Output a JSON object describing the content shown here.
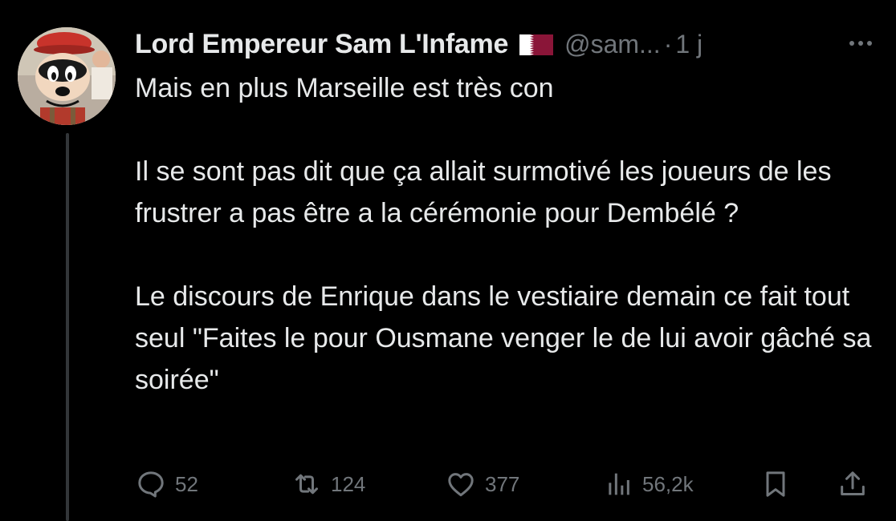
{
  "author": {
    "display_name": "Lord Empereur Sam L'Infame",
    "flag_icon": "qatar-flag-icon",
    "handle": "@sam...",
    "separator": "·",
    "time": "1 j"
  },
  "tweet": {
    "paragraphs": [
      "Mais en plus Marseille est très con",
      "Il se sont pas dit que ça allait surmotivé les joueurs de les frustrer a pas être a la cérémonie pour Dembélé ?",
      "Le discours de Enrique dans le vestiaire demain ce fait tout seul \"Faites le pour Ousmane venger le de lui avoir gâché sa soirée\""
    ]
  },
  "actions": {
    "reply": {
      "icon": "reply-icon",
      "count": "52"
    },
    "retweet": {
      "icon": "retweet-icon",
      "count": "124"
    },
    "like": {
      "icon": "heart-icon",
      "count": "377"
    },
    "views": {
      "icon": "views-chart-icon",
      "count": "56,2k"
    },
    "bookmark": {
      "icon": "bookmark-icon"
    },
    "share": {
      "icon": "share-icon"
    }
  },
  "colors": {
    "background": "#000000",
    "text_primary": "#e7e9ea",
    "text_secondary": "#71767b",
    "thread_line": "#333639",
    "flag_maroon": "#8a1538"
  }
}
